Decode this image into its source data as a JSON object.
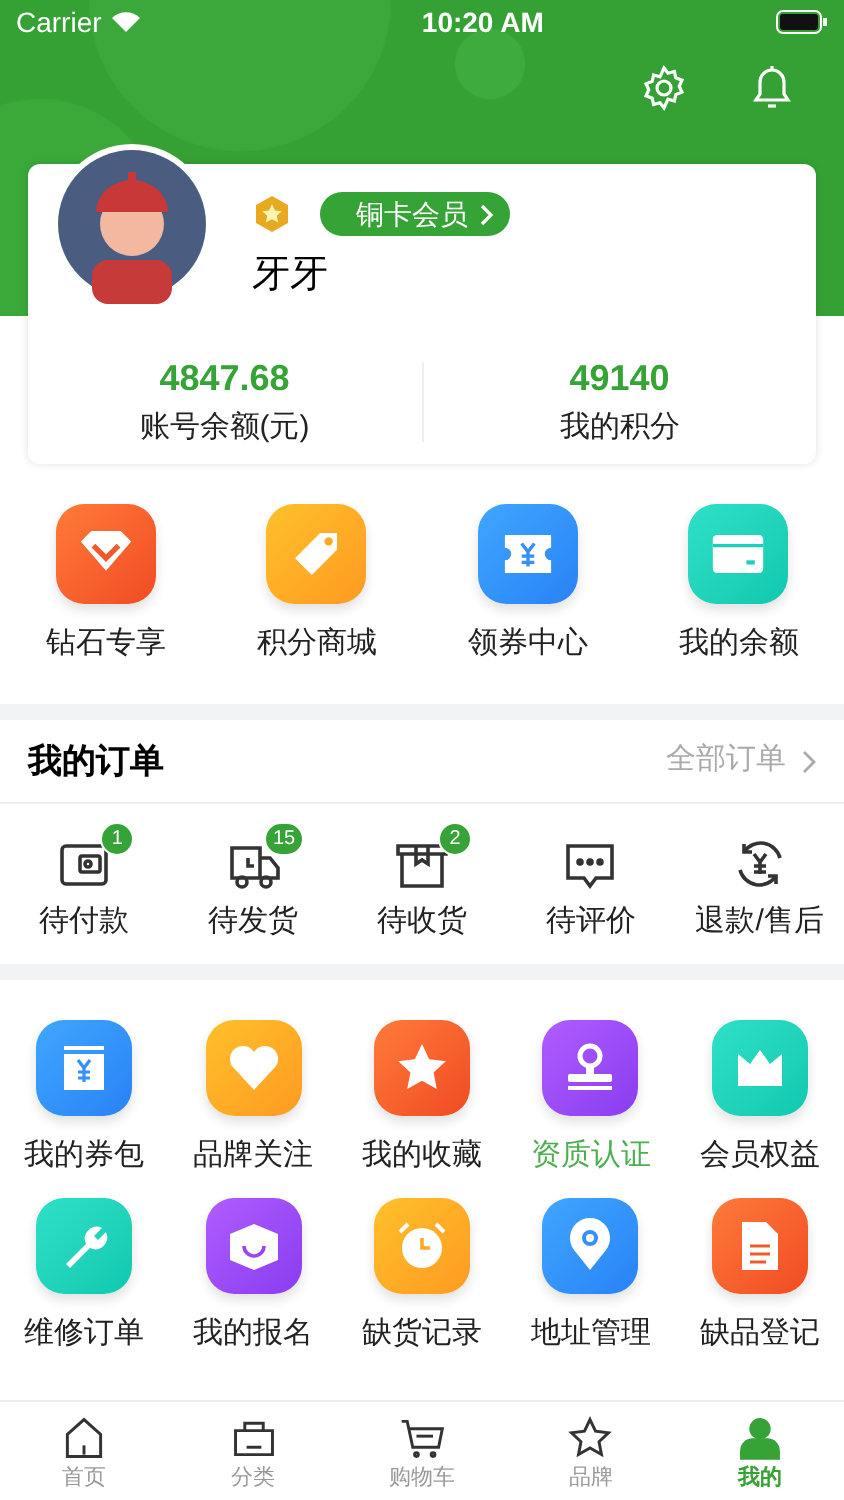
{
  "status_bar": {
    "carrier": "Carrier",
    "time": "10:20 AM"
  },
  "profile": {
    "member_level": "铜卡会员",
    "name": "牙牙"
  },
  "stats": [
    {
      "value": "4847.68",
      "label": "账号余额(元)"
    },
    {
      "value": "49140",
      "label": "我的积分"
    }
  ],
  "quick_links": [
    {
      "label": "钻石专享",
      "kind": "diamond"
    },
    {
      "label": "积分商城",
      "kind": "tag"
    },
    {
      "label": "领券中心",
      "kind": "ticket"
    },
    {
      "label": "我的余额",
      "kind": "card"
    }
  ],
  "orders": {
    "title": "我的订单",
    "all_link": "全部订单",
    "items": [
      {
        "label": "待付款",
        "kind": "wallet",
        "badge": "1"
      },
      {
        "label": "待发货",
        "kind": "truck",
        "badge": "15"
      },
      {
        "label": "待收货",
        "kind": "box",
        "badge": "2"
      },
      {
        "label": "待评价",
        "kind": "chat"
      },
      {
        "label": "退款/售后",
        "kind": "refund"
      }
    ]
  },
  "services": [
    {
      "label": "我的券包",
      "kind": "coupon-pack",
      "highlighted": false
    },
    {
      "label": "品牌关注",
      "kind": "heart",
      "highlighted": false
    },
    {
      "label": "我的收藏",
      "kind": "star",
      "highlighted": false
    },
    {
      "label": "资质认证",
      "kind": "stamp",
      "highlighted": true
    },
    {
      "label": "会员权益",
      "kind": "crown",
      "highlighted": false
    },
    {
      "label": "维修订单",
      "kind": "wrench",
      "highlighted": false
    },
    {
      "label": "我的报名",
      "kind": "cap",
      "highlighted": false
    },
    {
      "label": "缺货记录",
      "kind": "alarm",
      "highlighted": false
    },
    {
      "label": "地址管理",
      "kind": "pin",
      "highlighted": false
    },
    {
      "label": "缺品登记",
      "kind": "document",
      "highlighted": false
    }
  ],
  "tab_bar": [
    {
      "label": "首页",
      "kind": "home",
      "selected": false
    },
    {
      "label": "分类",
      "kind": "bag",
      "selected": false
    },
    {
      "label": "购物车",
      "kind": "cart",
      "selected": false
    },
    {
      "label": "品牌",
      "kind": "star",
      "selected": false
    },
    {
      "label": "我的",
      "kind": "person",
      "selected": true
    }
  ]
}
